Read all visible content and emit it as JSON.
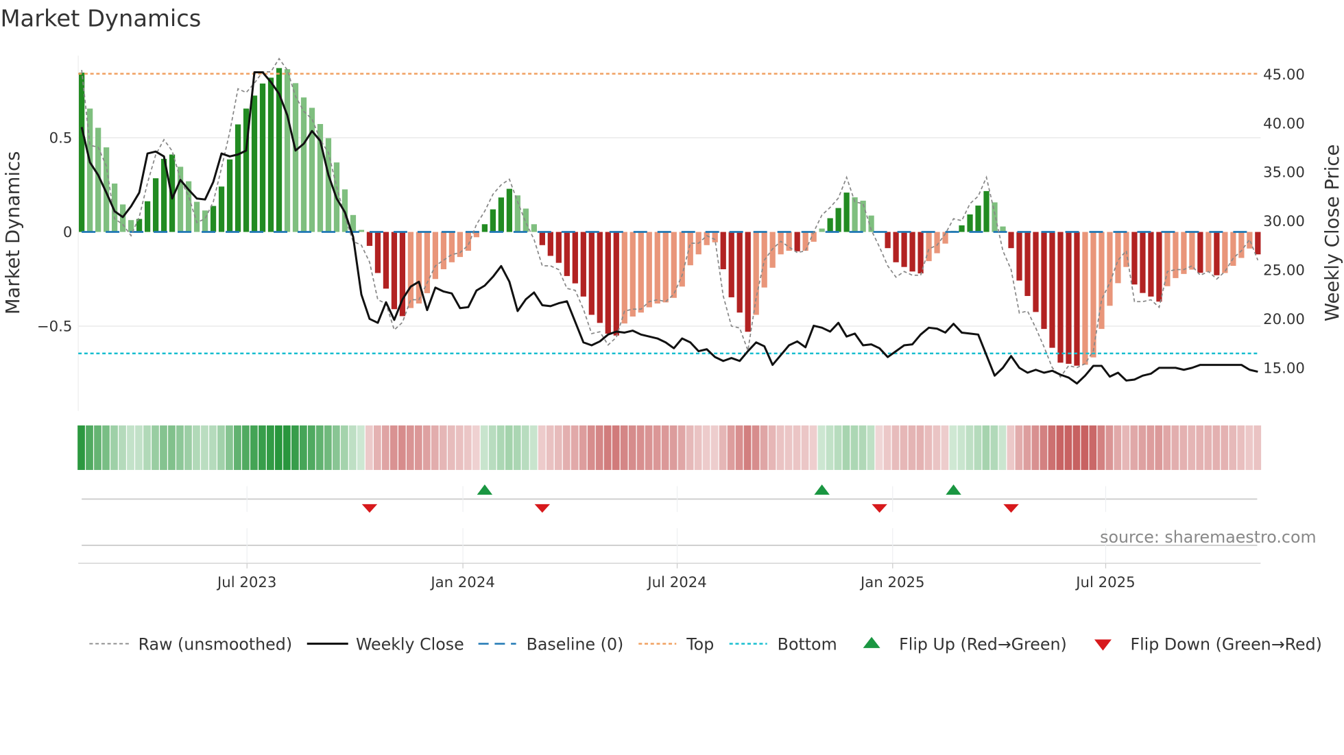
{
  "title": "Market Dynamics",
  "source": "source: sharemaestro.com",
  "chart_data": {
    "type": "bar",
    "title": "Market Dynamics",
    "ylabel": "Market Dynamics",
    "y2label": "Weekly Close Price",
    "ylim": [
      -0.95,
      0.936
    ],
    "y2lim": [
      10.6,
      46.9
    ],
    "yticks": [
      {
        "v": 0.5,
        "label": "0.5"
      },
      {
        "v": 0,
        "label": "0"
      },
      {
        "v": -0.5,
        "label": "−0.5"
      }
    ],
    "y2ticks": [
      {
        "v": 45,
        "label": "45.00"
      },
      {
        "v": 40,
        "label": "40.00"
      },
      {
        "v": 35,
        "label": "35.00"
      },
      {
        "v": 30,
        "label": "30.00"
      },
      {
        "v": 25,
        "label": "25.00"
      },
      {
        "v": 20,
        "label": "20.00"
      },
      {
        "v": 15,
        "label": "15.00"
      }
    ],
    "xticks": [
      {
        "week": 20.1,
        "label": "Jul 2023"
      },
      {
        "week": 46.35,
        "label": "Jan 2024"
      },
      {
        "week": 72.4,
        "label": "Jul 2024"
      },
      {
        "week": 98.6,
        "label": "Jan 2025"
      },
      {
        "week": 124.5,
        "label": "Jul 2025"
      }
    ],
    "top": 0.84,
    "bottom": -0.645,
    "baseline": 0,
    "momentum": [
      0.846,
      0.655,
      0.553,
      0.449,
      0.257,
      0.146,
      0.063,
      0.069,
      0.163,
      0.285,
      0.388,
      0.411,
      0.346,
      0.269,
      0.16,
      0.114,
      0.138,
      0.241,
      0.385,
      0.571,
      0.655,
      0.724,
      0.788,
      0.819,
      0.87,
      0.864,
      0.79,
      0.714,
      0.659,
      0.573,
      0.498,
      0.369,
      0.226,
      0.09,
      0.011,
      -0.074,
      -0.218,
      -0.301,
      -0.41,
      -0.447,
      -0.404,
      -0.38,
      -0.325,
      -0.25,
      -0.198,
      -0.161,
      -0.133,
      -0.1,
      -0.028,
      0.041,
      0.12,
      0.183,
      0.229,
      0.194,
      0.124,
      0.041,
      -0.07,
      -0.127,
      -0.164,
      -0.234,
      -0.273,
      -0.343,
      -0.44,
      -0.483,
      -0.54,
      -0.55,
      -0.486,
      -0.449,
      -0.428,
      -0.4,
      -0.38,
      -0.374,
      -0.35,
      -0.29,
      -0.177,
      -0.119,
      -0.07,
      -0.055,
      -0.198,
      -0.347,
      -0.428,
      -0.53,
      -0.44,
      -0.295,
      -0.19,
      -0.119,
      -0.1,
      -0.103,
      -0.1,
      -0.052,
      0.018,
      0.073,
      0.127,
      0.209,
      0.184,
      0.166,
      0.087,
      -0.004,
      -0.086,
      -0.161,
      -0.186,
      -0.21,
      -0.22,
      -0.155,
      -0.113,
      -0.062,
      0.006,
      0.035,
      0.093,
      0.14,
      0.217,
      0.157,
      0.029,
      -0.086,
      -0.258,
      -0.34,
      -0.425,
      -0.515,
      -0.615,
      -0.694,
      -0.7,
      -0.71,
      -0.705,
      -0.666,
      -0.515,
      -0.392,
      -0.272,
      -0.186,
      -0.279,
      -0.324,
      -0.343,
      -0.37,
      -0.288,
      -0.245,
      -0.223,
      -0.2,
      -0.217,
      -0.212,
      -0.23,
      -0.218,
      -0.18,
      -0.138,
      -0.088,
      -0.119
    ],
    "raw": [
      0.86,
      0.46,
      0.45,
      0.35,
      0.07,
      0.04,
      -0.02,
      0.08,
      0.26,
      0.41,
      0.49,
      0.43,
      0.28,
      0.19,
      0.05,
      0.07,
      0.16,
      0.34,
      0.53,
      0.76,
      0.74,
      0.79,
      0.85,
      0.85,
      0.92,
      0.86,
      0.72,
      0.64,
      0.6,
      0.49,
      0.42,
      0.24,
      0.08,
      -0.05,
      -0.07,
      -0.16,
      -0.36,
      -0.38,
      -0.52,
      -0.48,
      -0.36,
      -0.36,
      -0.27,
      -0.18,
      -0.15,
      -0.12,
      -0.11,
      -0.07,
      0.04,
      0.11,
      0.2,
      0.25,
      0.28,
      0.16,
      0.05,
      -0.04,
      -0.18,
      -0.18,
      -0.2,
      -0.3,
      -0.31,
      -0.41,
      -0.54,
      -0.53,
      -0.6,
      -0.56,
      -0.42,
      -0.41,
      -0.41,
      -0.37,
      -0.36,
      -0.37,
      -0.33,
      -0.23,
      -0.06,
      -0.06,
      -0.02,
      -0.04,
      -0.34,
      -0.5,
      -0.51,
      -0.63,
      -0.35,
      -0.15,
      -0.09,
      -0.05,
      -0.08,
      -0.11,
      -0.1,
      0.0,
      0.09,
      0.13,
      0.18,
      0.29,
      0.16,
      0.15,
      0.01,
      -0.08,
      -0.18,
      -0.24,
      -0.21,
      -0.23,
      -0.23,
      -0.09,
      -0.07,
      -0.01,
      0.07,
      0.06,
      0.15,
      0.19,
      0.29,
      0.1,
      -0.1,
      -0.2,
      -0.43,
      -0.42,
      -0.51,
      -0.61,
      -0.72,
      -0.77,
      -0.71,
      -0.72,
      -0.7,
      -0.63,
      -0.36,
      -0.27,
      -0.15,
      -0.1,
      -0.37,
      -0.37,
      -0.36,
      -0.4,
      -0.21,
      -0.2,
      -0.2,
      -0.18,
      -0.23,
      -0.21,
      -0.25,
      -0.21,
      -0.14,
      -0.1,
      -0.04,
      -0.15
    ],
    "close": [
      39.6,
      36.0,
      34.7,
      32.9,
      31.0,
      30.4,
      31.5,
      32.9,
      36.9,
      37.1,
      36.6,
      32.3,
      34.2,
      33.2,
      32.3,
      32.2,
      34.0,
      36.9,
      36.6,
      36.8,
      37.2,
      45.2,
      45.2,
      44.2,
      43.0,
      40.8,
      37.2,
      37.9,
      39.2,
      38.2,
      34.7,
      32.3,
      30.9,
      28.4,
      22.5,
      20.0,
      19.6,
      21.7,
      19.9,
      22.0,
      23.3,
      23.8,
      20.9,
      23.2,
      22.8,
      22.6,
      21.1,
      21.2,
      22.9,
      23.4,
      24.3,
      25.4,
      23.8,
      20.8,
      22.0,
      22.7,
      21.4,
      21.3,
      21.6,
      21.8,
      19.7,
      17.6,
      17.3,
      17.7,
      18.4,
      18.7,
      18.6,
      18.8,
      18.4,
      18.2,
      18.0,
      17.6,
      17.0,
      18.0,
      17.6,
      16.7,
      16.9,
      16.1,
      15.7,
      16.0,
      15.7,
      16.7,
      17.6,
      17.2,
      15.3,
      16.3,
      17.3,
      17.7,
      17.1,
      19.3,
      19.1,
      18.7,
      19.6,
      18.2,
      18.5,
      17.3,
      17.4,
      17.0,
      16.1,
      16.7,
      17.3,
      17.4,
      18.4,
      19.1,
      19.0,
      18.6,
      19.5,
      18.6,
      18.5,
      18.4,
      16.3,
      14.2,
      15.0,
      16.2,
      15.0,
      14.5,
      14.8,
      14.5,
      14.7,
      14.3,
      14.0,
      13.4,
      14.2,
      15.2,
      15.2,
      14.1,
      14.5,
      13.7,
      13.8,
      14.2,
      14.4,
      15.0,
      15.0,
      15.0,
      14.8,
      15.0,
      15.3,
      15.3,
      15.3,
      15.3,
      15.3,
      15.3,
      14.8,
      14.6
    ],
    "colors": {
      "up_strong": "#228b22",
      "up_weak": "#7fbf7f",
      "down_strong": "#b22222",
      "down_weak": "#e9967a",
      "close": "#111111",
      "raw": "#888888",
      "baseline": "#1f77b4",
      "top": "#f0a060",
      "bottom": "#17becf",
      "flip_up": "#1a9641",
      "flip_down": "#d7191c"
    },
    "legend": {
      "placement": "bottom",
      "items": [
        {
          "label": "Raw (unsmoothed)"
        },
        {
          "label": "Weekly Close"
        },
        {
          "label": "Baseline (0)"
        },
        {
          "label": "Top"
        },
        {
          "label": "Bottom"
        },
        {
          "label": "Flip Up (Red→Green)"
        },
        {
          "label": "Flip Down (Green→Red)"
        }
      ]
    }
  }
}
